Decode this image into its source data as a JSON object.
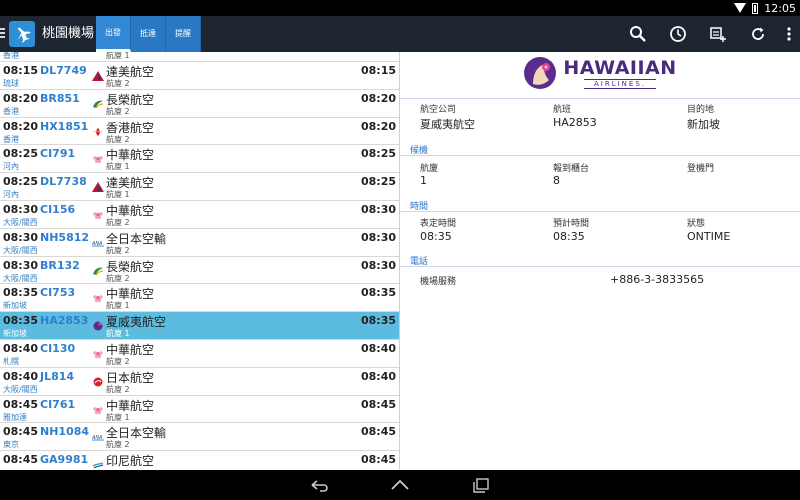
{
  "status": {
    "time": "12:05"
  },
  "app": {
    "title": "桃園機場"
  },
  "tabs": [
    {
      "label": "出發",
      "active": true
    },
    {
      "label": "抵達",
      "active": false
    },
    {
      "label": "提醒",
      "active": false
    }
  ],
  "actions": [
    "search-icon",
    "clock-icon",
    "schedule-add-icon",
    "refresh-icon",
    "overflow-menu-icon"
  ],
  "list": {
    "partial_top": {
      "city": "香港",
      "terminal": "航廈 1"
    },
    "flights": [
      {
        "time": "08:15",
        "flight": "DL7749",
        "airline": "達美航空",
        "estimated": "08:15",
        "city": "琉球",
        "terminal": "航廈 2",
        "logo": "delta-logo-icon",
        "selected": false
      },
      {
        "time": "08:20",
        "flight": "BR851",
        "airline": "長榮航空",
        "estimated": "08:20",
        "city": "香港",
        "terminal": "航廈 2",
        "logo": "evaair-logo-icon",
        "selected": false
      },
      {
        "time": "08:20",
        "flight": "HX1851",
        "airline": "香港航空",
        "estimated": "08:20",
        "city": "香港",
        "terminal": "航廈 2",
        "logo": "hkairlines-logo-icon",
        "selected": false
      },
      {
        "time": "08:25",
        "flight": "CI791",
        "airline": "中華航空",
        "estimated": "08:25",
        "city": "河內",
        "terminal": "航廈 1",
        "logo": "chinaairlines-logo-icon",
        "selected": false
      },
      {
        "time": "08:25",
        "flight": "DL7738",
        "airline": "達美航空",
        "estimated": "08:25",
        "city": "河內",
        "terminal": "航廈 1",
        "logo": "delta-logo-icon",
        "selected": false
      },
      {
        "time": "08:30",
        "flight": "CI156",
        "airline": "中華航空",
        "estimated": "08:30",
        "city": "大阪/關西",
        "terminal": "航廈 2",
        "logo": "chinaairlines-logo-icon",
        "selected": false
      },
      {
        "time": "08:30",
        "flight": "NH5812",
        "airline": "全日本空輸",
        "estimated": "08:30",
        "city": "大阪/關西",
        "terminal": "航廈 2",
        "logo": "ana-logo-icon",
        "selected": false
      },
      {
        "time": "08:30",
        "flight": "BR132",
        "airline": "長榮航空",
        "estimated": "08:30",
        "city": "大阪/關西",
        "terminal": "航廈 2",
        "logo": "evaair-logo-icon",
        "selected": false
      },
      {
        "time": "08:35",
        "flight": "CI753",
        "airline": "中華航空",
        "estimated": "08:35",
        "city": "新加坡",
        "terminal": "航廈 1",
        "logo": "chinaairlines-logo-icon",
        "selected": false
      },
      {
        "time": "08:35",
        "flight": "HA2853",
        "airline": "夏威夷航空",
        "estimated": "08:35",
        "city": "新加坡",
        "terminal": "航廈 1",
        "logo": "hawaiian-logo-icon",
        "selected": true
      },
      {
        "time": "08:40",
        "flight": "CI130",
        "airline": "中華航空",
        "estimated": "08:40",
        "city": "札幌",
        "terminal": "航廈 2",
        "logo": "chinaairlines-logo-icon",
        "selected": false
      },
      {
        "time": "08:40",
        "flight": "JL814",
        "airline": "日本航空",
        "estimated": "08:40",
        "city": "大阪/關西",
        "terminal": "航廈 2",
        "logo": "jal-logo-icon",
        "selected": false
      },
      {
        "time": "08:45",
        "flight": "CI761",
        "airline": "中華航空",
        "estimated": "08:45",
        "city": "雅加達",
        "terminal": "航廈 1",
        "logo": "chinaairlines-logo-icon",
        "selected": false
      },
      {
        "time": "08:45",
        "flight": "NH1084",
        "airline": "全日本空輸",
        "estimated": "08:45",
        "city": "東京",
        "terminal": "航廈 2",
        "logo": "ana-logo-icon",
        "selected": false
      },
      {
        "time": "08:45",
        "flight": "GA9981",
        "airline": "印尼航空",
        "estimated": "08:45",
        "city": "",
        "terminal": "",
        "logo": "garuda-logo-icon",
        "selected": false
      }
    ]
  },
  "details": {
    "brand": {
      "name": "HAWAIIAN",
      "sub": "AIRLINES."
    },
    "header_fields": [
      {
        "label": "航空公司",
        "value": "夏威夷航空"
      },
      {
        "label": "航班",
        "value": "HA2853"
      },
      {
        "label": "目的地",
        "value": "新加坡"
      }
    ],
    "section_terminal": {
      "title": "候機",
      "fields": [
        {
          "label": "航廈",
          "value": "1"
        },
        {
          "label": "報到櫃台",
          "value": "8"
        },
        {
          "label": "登機門",
          "value": ""
        }
      ]
    },
    "section_time": {
      "title": "時間",
      "fields": [
        {
          "label": "表定時間",
          "value": "08:35"
        },
        {
          "label": "預計時間",
          "value": "08:35"
        },
        {
          "label": "狀態",
          "value": "ONTIME"
        }
      ]
    },
    "section_phone": {
      "title": "電話",
      "label": "機場服務",
      "value": "+886-3-3833565"
    }
  },
  "colors": {
    "actionbar": "#1c2530",
    "tab": "#2a78c2",
    "selected_row": "#5bbcdf",
    "link_blue": "#2f7fcf",
    "hawaiian_purple": "#4b2a82"
  }
}
